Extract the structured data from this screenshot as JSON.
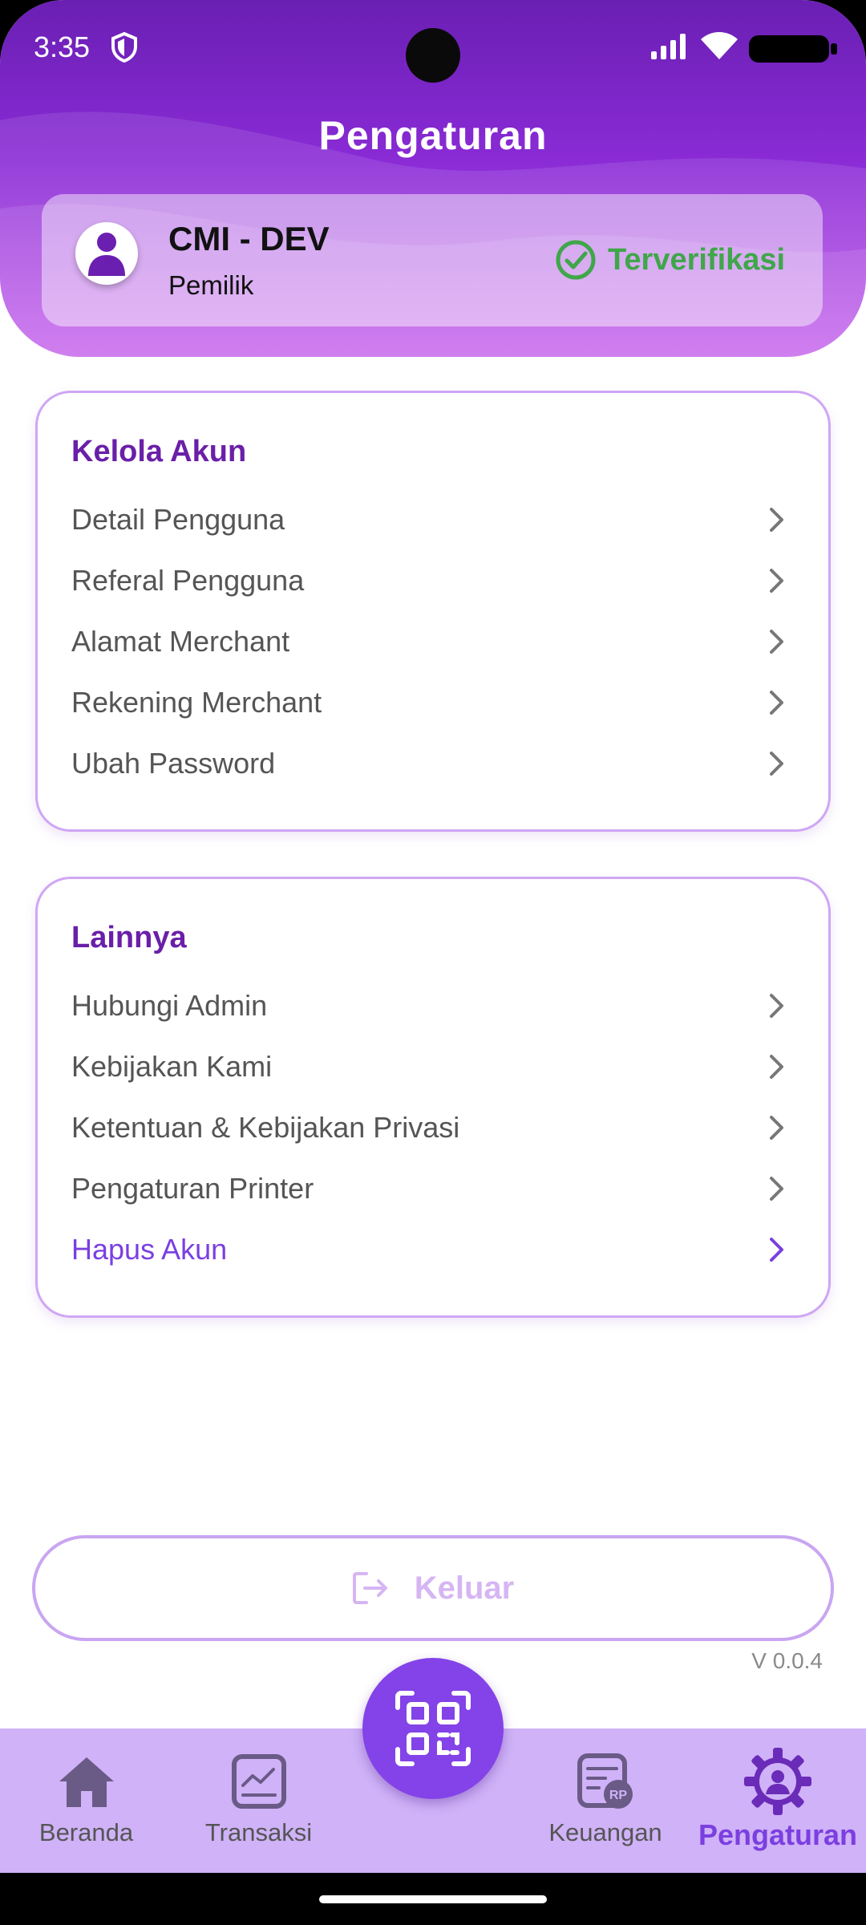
{
  "status_bar": {
    "time": "3:35"
  },
  "header": {
    "title": "Pengaturan"
  },
  "profile": {
    "name": "CMI - DEV",
    "role": "Pemilik",
    "verified_label": "Terverifikasi"
  },
  "sections": [
    {
      "title": "Kelola Akun",
      "items": [
        {
          "label": "Detail Pengguna"
        },
        {
          "label": "Referal Pengguna"
        },
        {
          "label": "Alamat Merchant"
        },
        {
          "label": "Rekening Merchant"
        },
        {
          "label": "Ubah Password"
        }
      ]
    },
    {
      "title": "Lainnya",
      "items": [
        {
          "label": "Hubungi Admin"
        },
        {
          "label": "Kebijakan Kami"
        },
        {
          "label": "Ketentuan & Kebijakan Privasi"
        },
        {
          "label": "Pengaturan Printer"
        },
        {
          "label": "Hapus Akun"
        }
      ]
    }
  ],
  "logout": {
    "label": "Keluar"
  },
  "version": "V 0.0.4",
  "bottom_nav": {
    "items": [
      {
        "label": "Beranda",
        "icon": "home-icon"
      },
      {
        "label": "Transaksi",
        "icon": "chart-icon"
      },
      {
        "label": "Keuangan",
        "icon": "finance-icon"
      },
      {
        "label": "Pengaturan",
        "icon": "gear-user-icon",
        "active": true
      }
    ],
    "center_icon": "qr-scan-icon"
  },
  "colors": {
    "primary": "#7b3fe0",
    "header_dark": "#6a1fb3",
    "verified_green": "#3fa649",
    "nav_bg": "#cfb2f7",
    "card_border": "#cfa6f4"
  }
}
